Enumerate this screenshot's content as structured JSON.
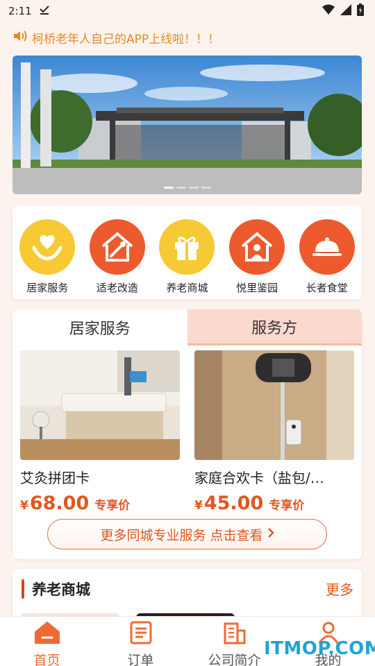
{
  "status_bar": {
    "time": "2:11"
  },
  "notice": {
    "text": "柯桥老年人自己的APP上线啦！！！"
  },
  "quick_menu": [
    {
      "label": "居家服务",
      "icon": "heart-hands-icon",
      "color": "#f7c934"
    },
    {
      "label": "适老改造",
      "icon": "house-tools-icon",
      "color": "#ec5a2e"
    },
    {
      "label": "养老商城",
      "icon": "gift-icon",
      "color": "#f7c934"
    },
    {
      "label": "悦里鉴园",
      "icon": "house-person-icon",
      "color": "#ec5a2e"
    },
    {
      "label": "长者食堂",
      "icon": "food-cloche-icon",
      "color": "#ec5a2e"
    }
  ],
  "service": {
    "tabs": [
      "居家服务",
      "服务方"
    ],
    "products": [
      {
        "title": "艾灸拼团卡",
        "currency": "¥",
        "price": "68.00",
        "tag": "专享价"
      },
      {
        "title": "家庭合欢卡（盐包/…",
        "currency": "¥",
        "price": "45.00",
        "tag": "专享价"
      }
    ],
    "more_label": "更多同城专业服务 点击查看"
  },
  "mall": {
    "title": "养老商城",
    "more": "更多"
  },
  "tabbar": [
    {
      "label": "首页",
      "icon": "home-icon",
      "active": true
    },
    {
      "label": "订单",
      "icon": "order-list-icon",
      "active": false
    },
    {
      "label": "公司简介",
      "icon": "building-icon",
      "active": false
    },
    {
      "label": "我的",
      "icon": "person-icon",
      "active": false
    }
  ],
  "watermark": {
    "text": "ITMOP.COM"
  },
  "colors": {
    "accent": "#ec5a2e",
    "price": "#e2561c",
    "yellow": "#f7c934",
    "background": "#fdf3ee"
  }
}
